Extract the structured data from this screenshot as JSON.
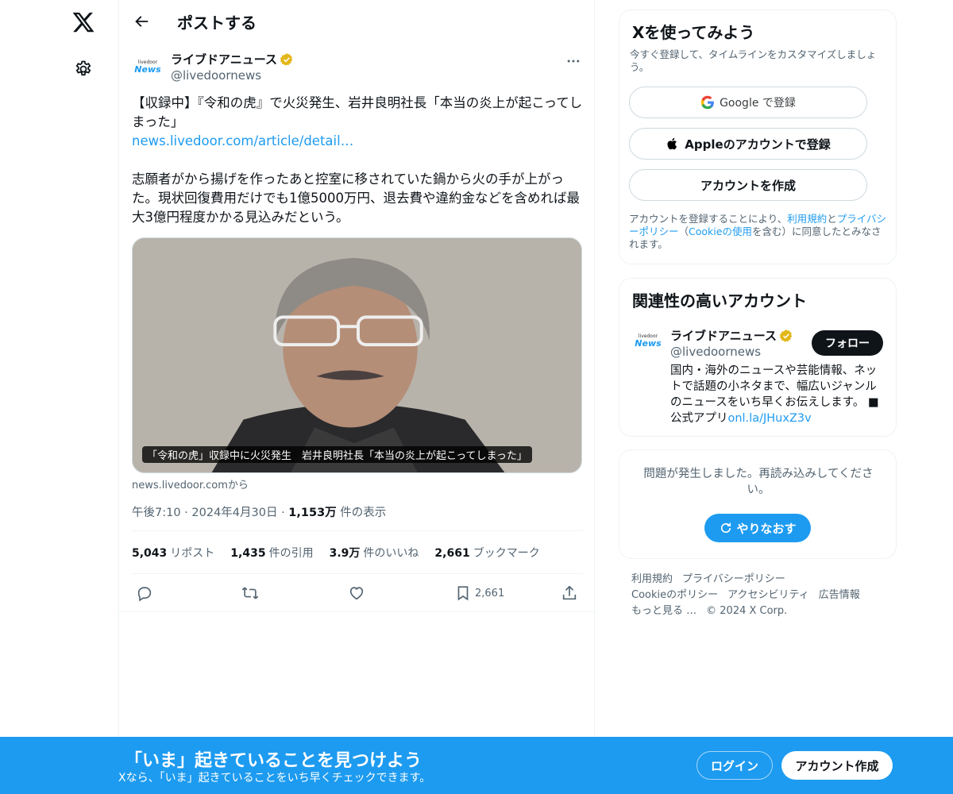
{
  "header": {
    "title": "ポストする"
  },
  "author": {
    "name": "ライブドアニュース",
    "handle": "@livedoornews",
    "avatar_line1": "livedoor",
    "avatar_line2": "News"
  },
  "post": {
    "line1": "【収録中】『令和の虎』で火災発生、岩井良明社長「本当の炎上が起こってしまった」",
    "link": "news.livedoor.com/article/detail…",
    "body": "志願者がから揚げを作ったあと控室に移されていた鍋から火の手が上がった。現状回復費用だけでも1億5000万円、退去費や違約金などを含めれば最大3億円程度かかる見込みだという。",
    "media_caption": "「令和の虎」収録中に火災発生　岩井良明社長「本当の炎上が起こってしまった」",
    "source": "news.livedoor.comから",
    "time": "午後7:10 · 2024年4月30日 · ",
    "views_num": "1,153万",
    "views_label": " 件の表示"
  },
  "stats": [
    {
      "num": "5,043",
      "label": "リポスト"
    },
    {
      "num": "1,435",
      "label": "件の引用"
    },
    {
      "num": "3.9万",
      "label": "件のいいね"
    },
    {
      "num": "2,661",
      "label": "ブックマーク"
    }
  ],
  "actions": {
    "bookmark_count": "2,661"
  },
  "signup_card": {
    "title": "Xを使ってみよう",
    "desc": "今すぐ登録して、タイムラインをカスタマイズしましょう。",
    "google": "Google で登録",
    "apple": "Appleのアカウントで登録",
    "create": "アカウントを作成",
    "terms_1": "アカウントを登録することにより、",
    "terms_link1": "利用規約",
    "terms_2": "と",
    "terms_link2": "プライバシーポリシー",
    "terms_3": "（",
    "terms_link3": "Cookieの使用",
    "terms_4": "を含む）に同意したとみなされます。"
  },
  "related": {
    "title": "関連性の高いアカウント",
    "name": "ライブドアニュース",
    "handle": "@livedoornews",
    "follow": "フォロー",
    "bio": "国内・海外のニュースや芸能情報、ネットで話題の小ネタまで、幅広いジャンルのニュースをいち早くお伝えします。 ■公式アプリ",
    "bio_link": "onl.la/JHuxZ3v"
  },
  "error": {
    "text": "問題が発生しました。再読み込みしてください。",
    "retry": "やりなおす"
  },
  "footer": [
    "利用規約",
    "プライバシーポリシー",
    "Cookieのポリシー",
    "アクセシビリティ",
    "広告情報",
    "もっと見る …",
    "© 2024 X Corp."
  ],
  "bottombar": {
    "title": "「いま」起きていることを見つけよう",
    "sub": "Xなら、「いま」起きていることをいち早くチェックできます。",
    "login": "ログイン",
    "signup": "アカウント作成"
  },
  "colors": {
    "accent": "#1d9bf0",
    "text": "#0f1419",
    "muted": "#536471"
  }
}
